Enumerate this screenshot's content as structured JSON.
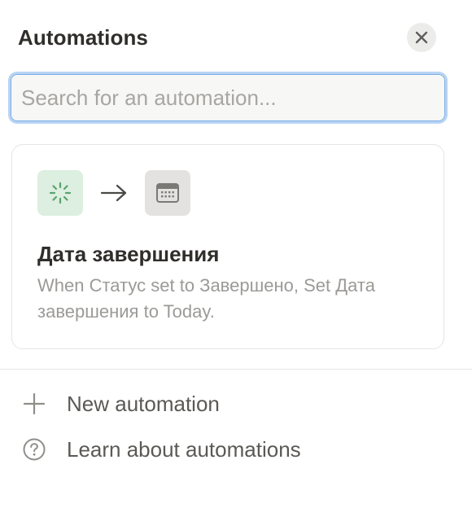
{
  "panel": {
    "title": "Automations",
    "close_icon": "close-icon"
  },
  "search": {
    "placeholder": "Search for an automation...",
    "value": ""
  },
  "automations": [
    {
      "trigger_icon": "loading-spinner-icon",
      "trigger_icon_bg": "#dcefe0",
      "arrow_icon": "arrow-right-icon",
      "action_icon": "calendar-icon",
      "action_icon_bg": "#e3e2e0",
      "title": "Дата завершения",
      "description": "When Статус set to Завершено, Set Дата завершения to Today."
    }
  ],
  "menu": {
    "new_automation": {
      "icon": "plus-icon",
      "label": "New automation"
    },
    "learn": {
      "icon": "help-circle-icon",
      "label": "Learn about automations"
    }
  },
  "colors": {
    "focus_ring": "#7aaee6",
    "text_primary": "#2f2e2b",
    "text_secondary": "#9b9a97"
  }
}
